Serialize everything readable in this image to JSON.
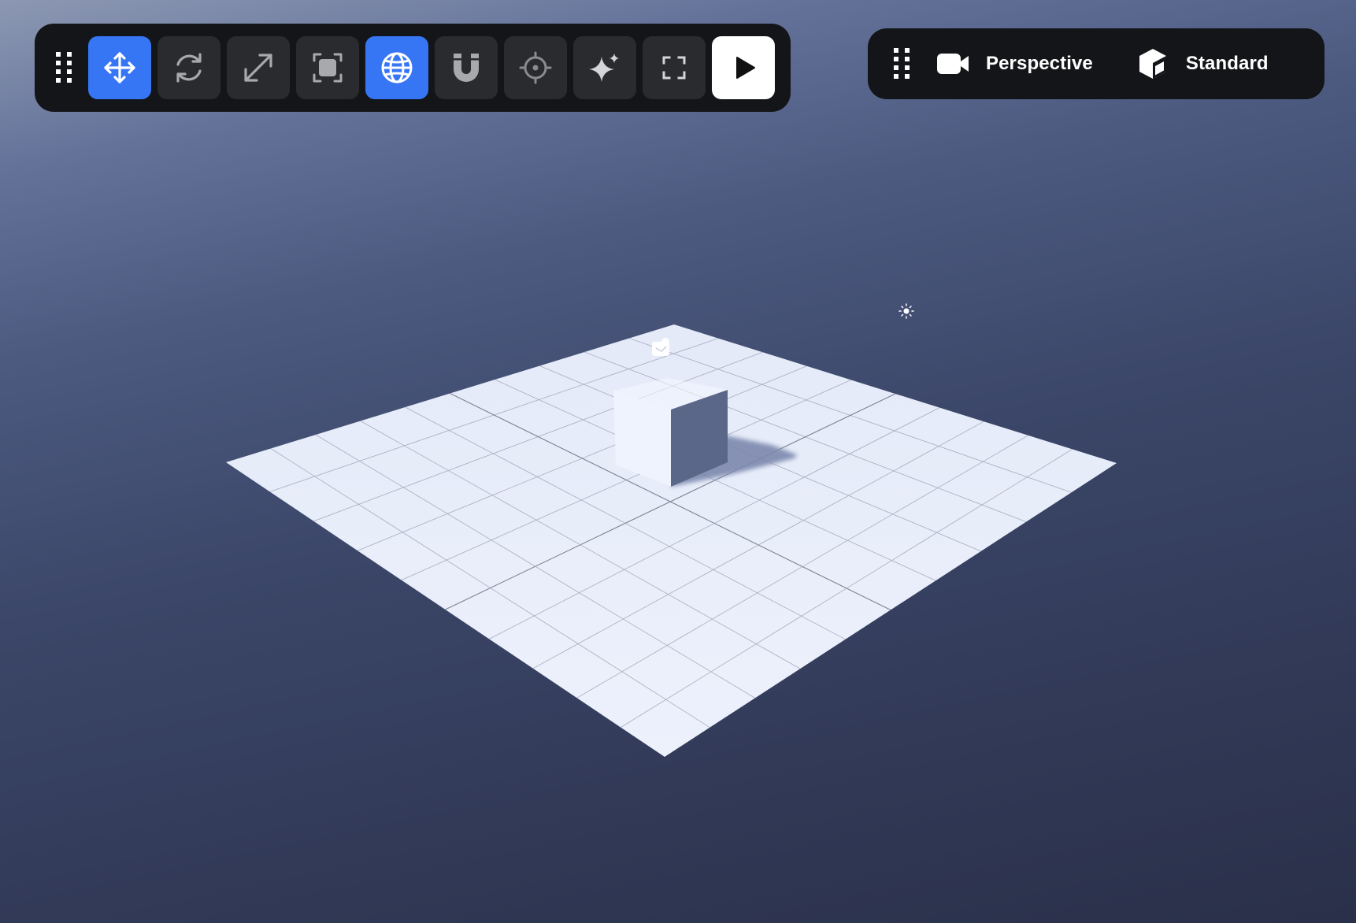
{
  "toolbar": {
    "tools": [
      {
        "name": "move",
        "icon": "move-arrows-icon",
        "active": true
      },
      {
        "name": "rotate",
        "icon": "rotate-icon",
        "active": false
      },
      {
        "name": "scale",
        "icon": "scale-diagonal-icon",
        "active": false
      },
      {
        "name": "rect-transform",
        "icon": "bounding-box-icon",
        "active": false
      },
      {
        "name": "world-space",
        "icon": "globe-icon",
        "active": true
      },
      {
        "name": "snap",
        "icon": "magnet-icon",
        "active": false
      },
      {
        "name": "pivot",
        "icon": "crosshair-icon",
        "active": false
      },
      {
        "name": "effects",
        "icon": "sparkle-icon",
        "active": false
      },
      {
        "name": "frame",
        "icon": "fullscreen-corners-icon",
        "active": false
      },
      {
        "name": "play",
        "icon": "play-icon",
        "active": false
      }
    ]
  },
  "view_panel": {
    "camera": {
      "icon": "video-camera-icon",
      "label": "Perspective"
    },
    "shading": {
      "icon": "cube-icon",
      "label": "Standard"
    }
  },
  "scene": {
    "objects": [
      "ground-plane",
      "cube",
      "camera-gizmo",
      "light-gizmo"
    ]
  },
  "colors": {
    "accent": "#3676f5",
    "panel_bg": "#141518",
    "button_bg": "#2a2b2e"
  }
}
